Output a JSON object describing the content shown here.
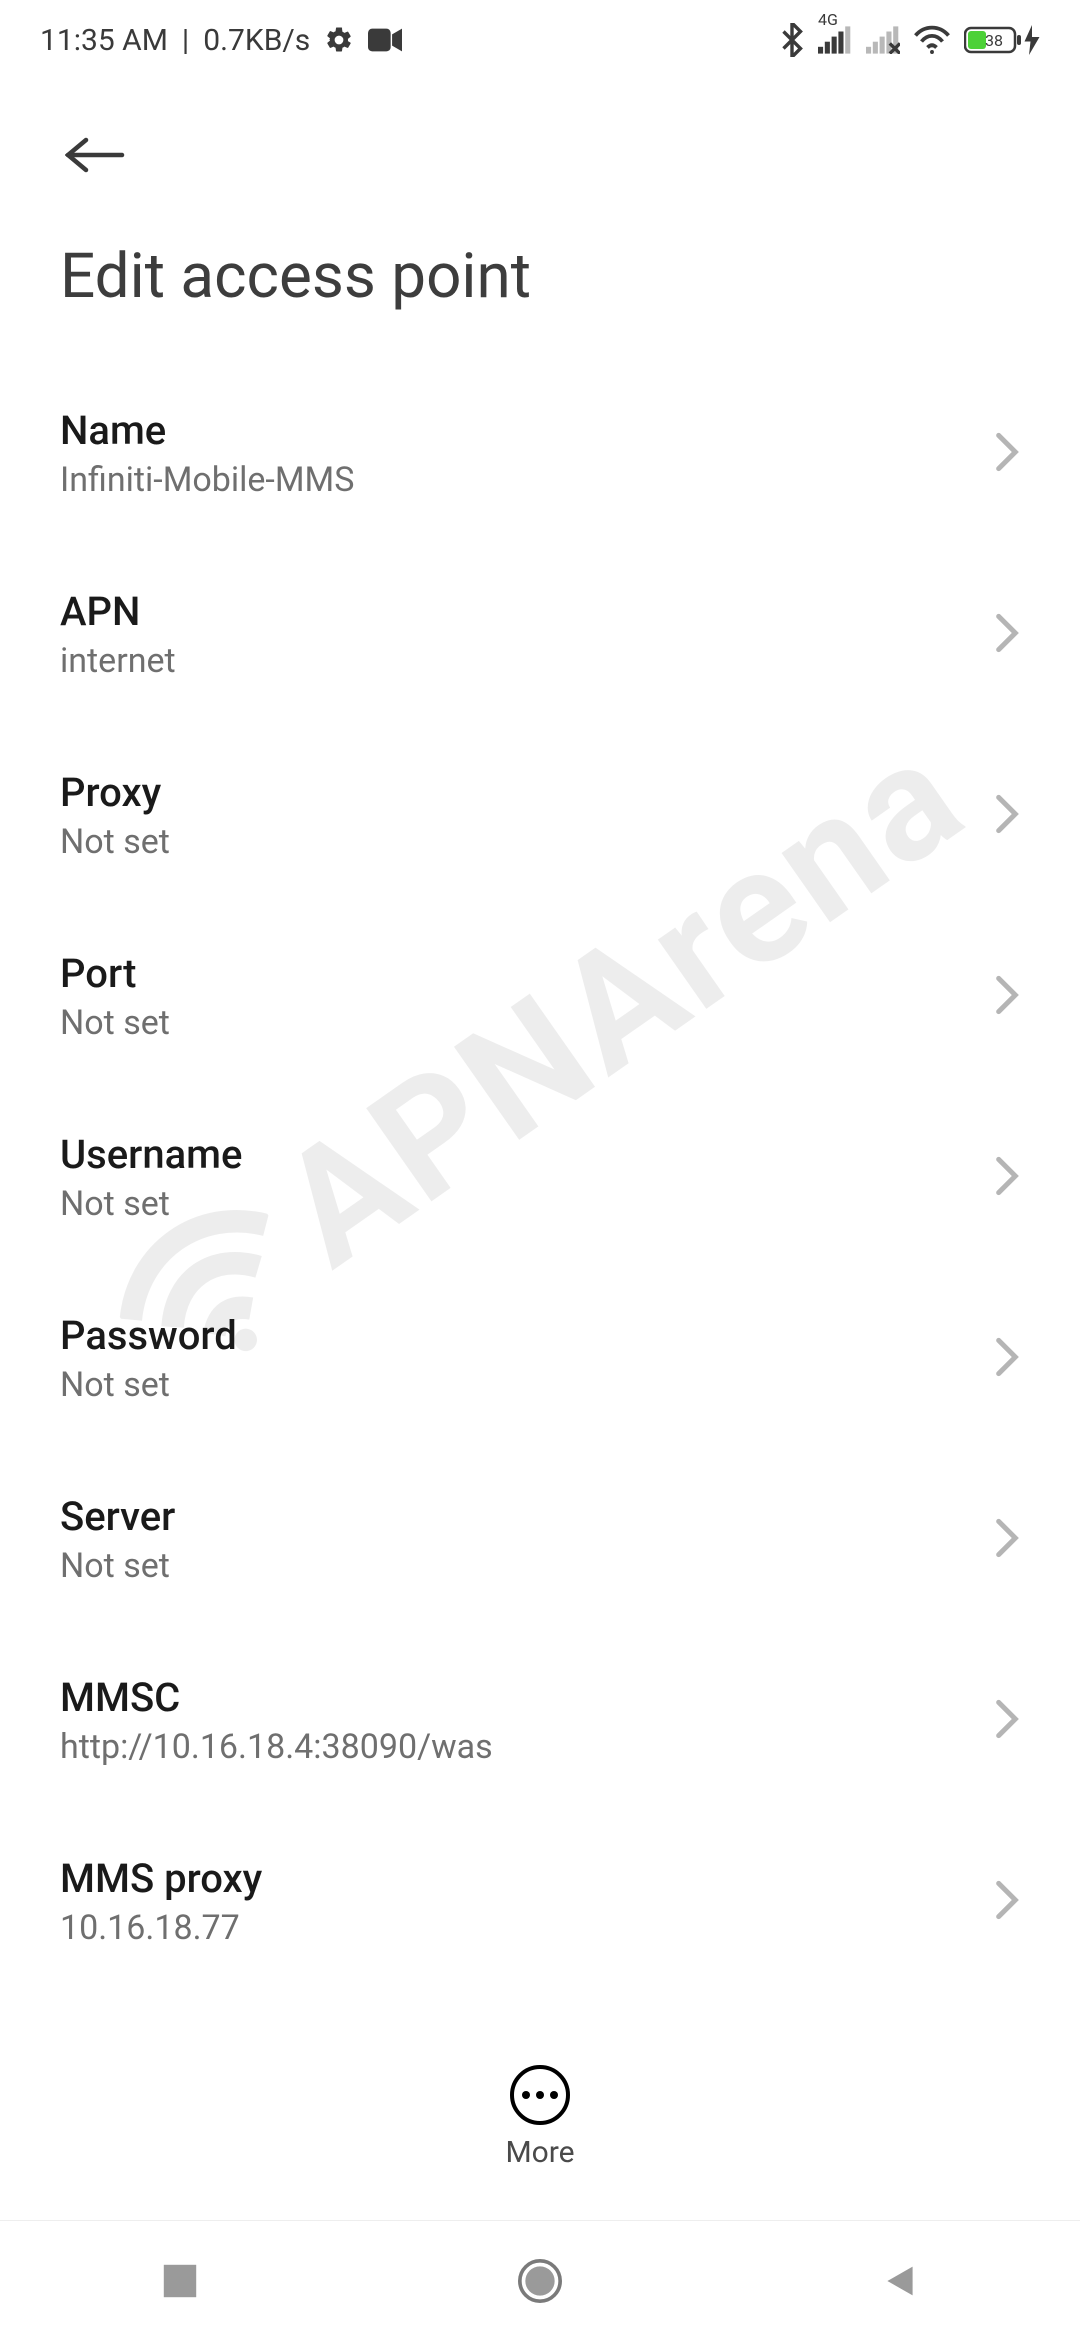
{
  "status": {
    "time": "11:35 AM",
    "separator": "|",
    "speed": "0.7KB/s",
    "network_label": "4G",
    "battery_percent": "38"
  },
  "header": {
    "title": "Edit access point"
  },
  "settings": [
    {
      "label": "Name",
      "value": "Infiniti-Mobile-MMS"
    },
    {
      "label": "APN",
      "value": "internet"
    },
    {
      "label": "Proxy",
      "value": "Not set"
    },
    {
      "label": "Port",
      "value": "Not set"
    },
    {
      "label": "Username",
      "value": "Not set"
    },
    {
      "label": "Password",
      "value": "Not set"
    },
    {
      "label": "Server",
      "value": "Not set"
    },
    {
      "label": "MMSC",
      "value": "http://10.16.18.4:38090/was"
    },
    {
      "label": "MMS proxy",
      "value": "10.16.18.77"
    }
  ],
  "overflow": {
    "more_label": "More"
  },
  "watermark": {
    "text": "APNArena"
  }
}
